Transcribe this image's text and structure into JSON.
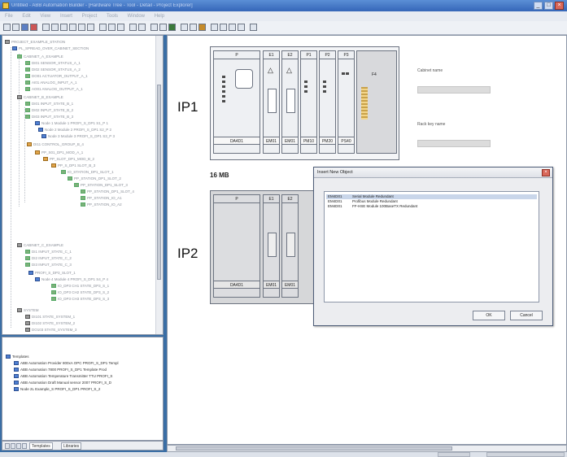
{
  "window": {
    "title": "Untitled - ABB Automation Builder - [Hardware Tree - Tool - Detail - Project Explorer]"
  },
  "menu": [
    "File",
    "Edit",
    "View",
    "Insert",
    "Project",
    "Tools",
    "Window",
    "Help"
  ],
  "tree": [
    "PROJECT_EXAMPLE_STATION",
    "PL_SPREAD_OVER_CABINET_SECTION",
    "CABINET_A_EXAMPLE",
    "DI01 SENSOR_STATUS_A_1",
    "DI02 SENSOR_STATUS_A_2",
    "DO01 ACTUATOR_OUTPUT_A_1",
    "AI01 ANALOG_INPUT_A_1",
    "AO01 ANALOG_OUTPUT_A_1",
    "CABINET_B_EXAMPLE",
    "DI01 INPUT_STATE_B_1",
    "DI02 INPUT_STATE_B_2",
    "DI03 INPUT_STATE_B_3",
    "Node 1 Module 1 PROFI_S_DP1 S1_P 1",
    "Node 2 Module 2 PROFI_S_DP1 S2_P 2",
    "Node 3 Module 3 PROFI_S_DP1 S3_P 3",
    "DI11 CONTROL_GROUP_B_4",
    "PP_S01_DP1_MOD_A_1",
    "PP_SLOT_DP1_MOD_B_2",
    "PP_S_DP1 SLOT_B_3",
    "IO_STATION_DP1_SLOT_1",
    "PP_STATION_DP1_SLOT_2",
    "PP_STATION_DP1_SLOT_3",
    "PP_STATION_DP1_SLOT_4",
    "PP_STATION_IO_A1",
    "PP_STATION_IO_A2",
    "CABINET_C_EXAMPLE",
    "DI1 INPUT_STATE_C_1",
    "DI2 INPUT_STATE_C_2",
    "DI3 INPUT_STATE_C_3",
    "PROFI_S_DP3_SLOT_1",
    "Node 4 Module 4 PROFI_S_DP1 S4_P 4",
    "IO_DP3 CH1 STATE_DP3_S_1",
    "IO_DP3 CH2 STATE_DP3_S_2",
    "IO_DP3 CH3 STATE_DP3_S_3",
    "SYSTEM",
    "DI101 STATE_SYSTEM_1",
    "DI102 STATE_SYSTEM_2",
    "DO103 STATE_SYSTEM_3",
    "AI104 STATE_SYSTEM_4"
  ],
  "templates_tree": [
    "Templates",
    "ABB Automation Provider 800xA OPC PROFI_S_DP1 Templ",
    "ABB Automation 7800 PROFI_S_DP1 Template Prod",
    "ABB Automation Temperature Transmitter TTU PROFI_S",
    "ABB Automation Draft Manual sensor 2007 PROFI_S_D",
    "Node 2L Example_S PROFI_S_DP1 PROFI_S_2"
  ],
  "bottom_tabs": {
    "templates": "Templates",
    "libraries": "Libraries"
  },
  "racks": {
    "ip1_label": "IP1",
    "ip2_label": "IP2",
    "memory_label": "16 MB",
    "ip1_headers": [
      "P",
      "E1",
      "E2",
      "P1",
      "P2",
      "P3"
    ],
    "ip1_footers": [
      "DA4D1",
      "EM01",
      "EM01",
      "PM10",
      "PM20",
      "PS40"
    ],
    "ip1_extra_slot": "F4",
    "ip2_headers": [
      "P",
      "E1",
      "E2"
    ],
    "ip2_footers": [
      "DA4D1",
      "EM01",
      "EM01"
    ]
  },
  "properties": {
    "cabinet_name_label": "Cabinet name",
    "rack_key_label": "Rack key name"
  },
  "dialog": {
    "title": "Insert New Object",
    "close": "×",
    "items": [
      {
        "code": "EM4D01",
        "text": "Serial Module Redundant"
      },
      {
        "code": "EM4D01",
        "text": "Profibus Module Redundant"
      },
      {
        "code": "EM4D01",
        "text": "FF-HSE Module 100BaseTX Redundant"
      }
    ],
    "ok": "OK",
    "cancel": "Cancel"
  }
}
